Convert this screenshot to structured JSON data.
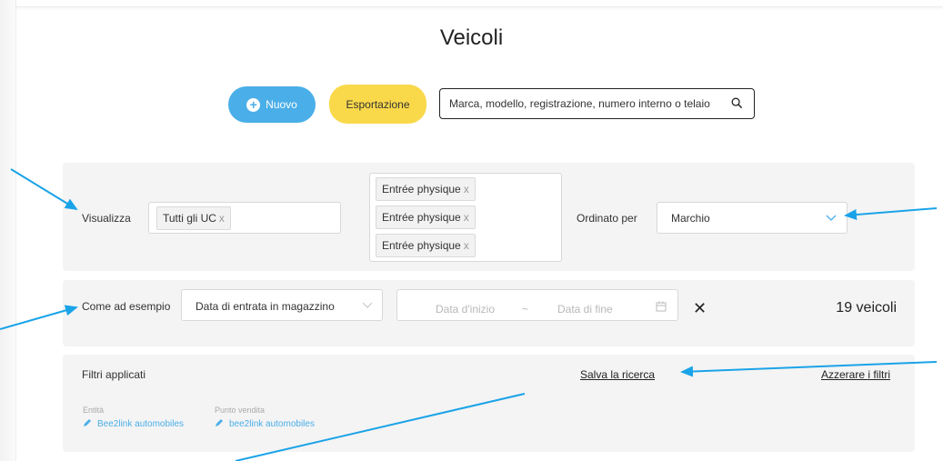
{
  "page": {
    "title": "Veicoli"
  },
  "toolbar": {
    "new_label": "Nuovo",
    "export_label": "Esportazione",
    "search_placeholder": "Marca, modello, registrazione, numero interno o telaio"
  },
  "filters": {
    "view_label": "Visualizza",
    "view_chip": "Tutti gli UC",
    "status_chips": [
      "Entrée physique",
      "Entrée physique",
      "Entrée physique"
    ],
    "order_label": "Ordinato per",
    "order_value": "Marchio",
    "as_example_label": "Come ad esempio",
    "date_type_value": "Data di entrata in magazzino",
    "date_start_placeholder": "Data d'inizio",
    "date_separator": "~",
    "date_end_placeholder": "Data di fine",
    "clear_symbol": "✕",
    "count_text": "19 veicoli"
  },
  "applied": {
    "title": "Filtri applicati",
    "save_link": "Salva la ricerca",
    "reset_link": "Azzerare i filtri",
    "entity_label": "Entità",
    "entity_value": "Bee2link automobiles",
    "point_label": "Punto vendita",
    "point_value": "bee2link automobiles"
  },
  "icons": {
    "plus": "plus-circle-icon",
    "search": "magnifier-icon",
    "chevron": "chevron-down-icon",
    "calendar": "calendar-icon",
    "pencil": "pencil-icon"
  },
  "colors": {
    "primary_blue": "#4aaee8",
    "export_yellow": "#f9d84a",
    "annotation_arrow": "#1aa3e8"
  }
}
